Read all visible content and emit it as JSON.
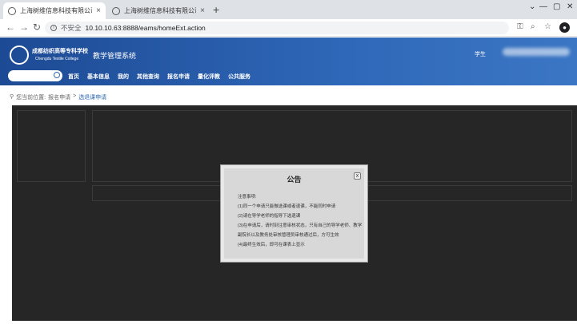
{
  "browser": {
    "tabs": [
      {
        "title": "上海树维信息科技有限公司教学管",
        "active": true
      },
      {
        "title": "上海树维信息科技有限公司教学管",
        "active": false
      }
    ],
    "new_tab": "+",
    "close": "×",
    "security_label": "不安全",
    "url": "10.10.10.63:8888/eams/homeExt.action",
    "window_controls": [
      "⌄",
      "—",
      "▢",
      "✕"
    ]
  },
  "header": {
    "school_cn": "成都纺织高等专科学校",
    "school_en": "Chengdu Textile College",
    "system_name": "教学管理系统",
    "role": "学生",
    "search_placeholder": "",
    "menu": [
      "首页",
      "基本信息",
      "我的",
      "其他查询",
      "报名申请",
      "量化评教",
      "公共服务"
    ]
  },
  "breadcrumb": {
    "prefix": "您当前位置:",
    "section": "报名申请",
    "separator": ">",
    "current": "选退课申请"
  },
  "modal": {
    "title": "公告",
    "close": "x",
    "lines": [
      "注意事项:",
      "(1)同一个申请只能做选课或者退课，不能同时申请",
      "(2)请在导学老师的指导下选退课",
      "(3)在申请后，请时刻注意审核状态，只有自己的导学老师、教学副院长以及教务处审核管理员审核通过后，方可生效",
      "(4)最终生效后，即可在课表上显示"
    ]
  },
  "colors": {
    "header_blue": "#2f68b8",
    "overlay": "#262626"
  }
}
